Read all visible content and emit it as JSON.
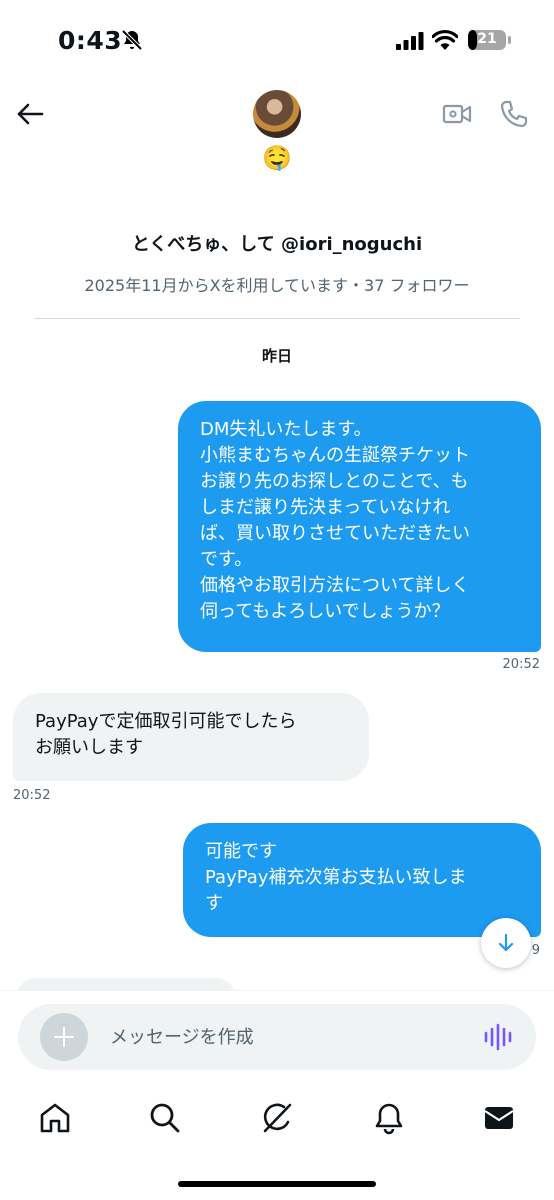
{
  "status": {
    "time": "0:43",
    "battery": "21"
  },
  "header": {
    "emoji": "🤤",
    "profile_name": "とくべちゅ、して @iori_noguchi",
    "profile_meta": "2025年11月からXを利用しています・37 フォロワー",
    "date_label": "昨日"
  },
  "messages": [
    {
      "direction": "sent",
      "text": "DM失礼いたします。\n小熊まむちゃんの生誕祭チケット\nお譲り先のお探しとのことで、も\nしまだ譲り先決まっていなけれ\nば、買い取りさせていただきたい\nです。\n価格やお取引方法について詳しく\n伺ってもよろしいでしょうか？",
      "time": "20:52"
    },
    {
      "direction": "received",
      "text": "PayPayで定価取引可能でしたら\nお願いします",
      "time": "20:52"
    },
    {
      "direction": "sent",
      "text": "可能です\nPayPay補充次第お支払い致しま\nす",
      "time": "9"
    }
  ],
  "composer": {
    "placeholder": "メッセージを作成"
  },
  "icons": {
    "back": "arrow-left-icon",
    "video": "video-camera-icon",
    "phone": "phone-icon",
    "plus": "plus-icon",
    "voice": "voice-waveform-icon",
    "nav": [
      "home-icon",
      "search-icon",
      "grok-icon",
      "bell-icon",
      "mail-icon"
    ]
  },
  "colors": {
    "accent": "#1d9bf0",
    "received_bubble": "#eff3f4",
    "voice": "#7856ff"
  }
}
